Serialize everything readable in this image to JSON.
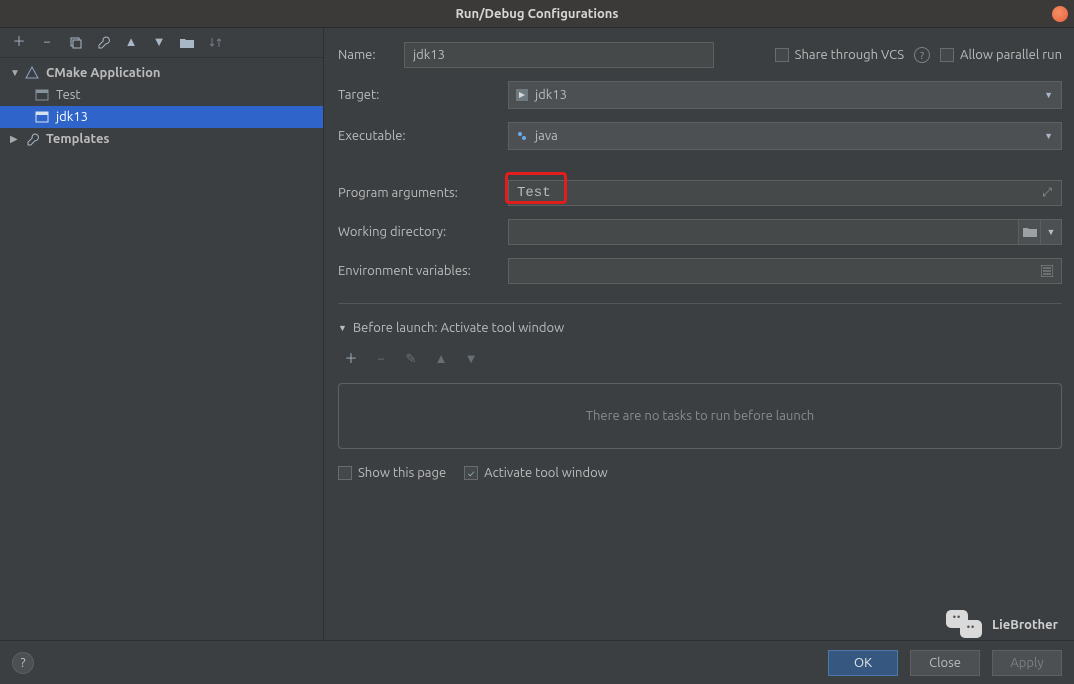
{
  "title": "Run/Debug Configurations",
  "toolbar_icons": [
    "add",
    "remove",
    "copy",
    "wrench",
    "up",
    "down",
    "folder",
    "sort"
  ],
  "tree": {
    "group": "CMake Application",
    "items": [
      "Test",
      "jdk13"
    ],
    "selected": "jdk13",
    "templates": "Templates"
  },
  "form": {
    "name_label": "Name:",
    "name_value": "jdk13",
    "share_label": "Share through VCS",
    "allow_parallel_label": "Allow parallel run",
    "target_label": "Target:",
    "target_value": "jdk13",
    "executable_label": "Executable:",
    "executable_value": "java",
    "program_args_label": "Program arguments:",
    "program_args_value": "Test",
    "working_dir_label": "Working directory:",
    "working_dir_value": "",
    "env_label": "Environment variables:",
    "env_value": ""
  },
  "before_launch": {
    "header": "Before launch: Activate tool window",
    "empty_text": "There are no tasks to run before launch",
    "show_this_page": "Show this page",
    "activate_tool_window": "Activate tool window"
  },
  "buttons": {
    "ok": "OK",
    "cancel": "Close",
    "apply": "Apply",
    "help": "?"
  },
  "watermark": "LieBrother"
}
